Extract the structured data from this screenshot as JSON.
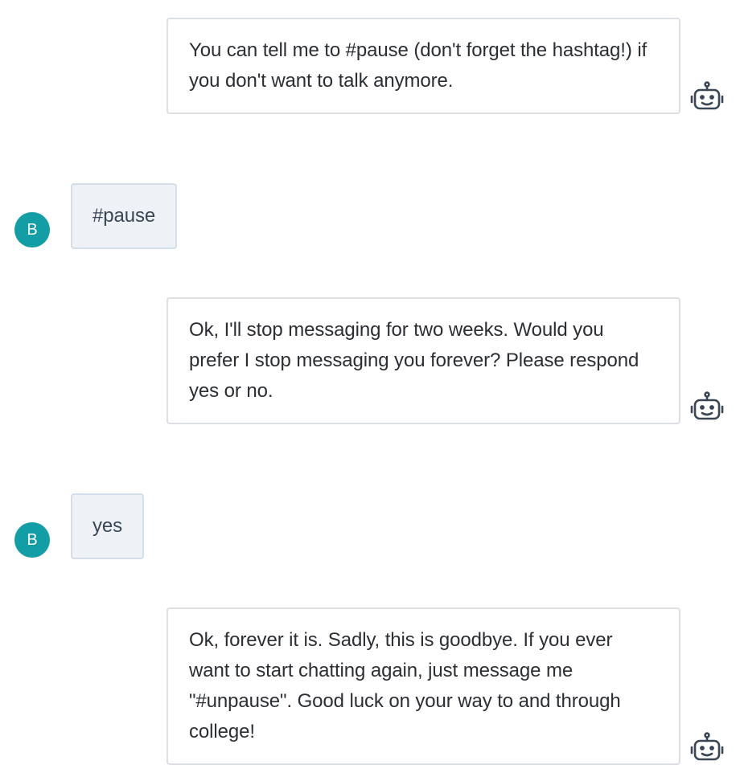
{
  "messages": [
    {
      "sender": "bot",
      "text": "You can tell me to #pause (don't forget the hashtag!) if you don't want to talk anymore."
    },
    {
      "sender": "user",
      "avatar_initial": "B",
      "text": "#pause"
    },
    {
      "sender": "bot",
      "text": "Ok, I'll stop messaging for two weeks. Would you prefer I stop messaging you forever? Please respond yes or no."
    },
    {
      "sender": "user",
      "avatar_initial": "B",
      "text": "yes"
    },
    {
      "sender": "bot",
      "text": "Ok, forever it is. Sadly, this is goodbye. If you ever want to start chatting again, just message me \"#unpause\". Good luck on your way to and through college!"
    }
  ],
  "icons": {
    "bot_avatar": "robot-icon"
  },
  "colors": {
    "user_avatar_bg": "#139ea6",
    "user_bubble_bg": "#eef2f6",
    "bot_bubble_border": "#dcdfe3"
  }
}
